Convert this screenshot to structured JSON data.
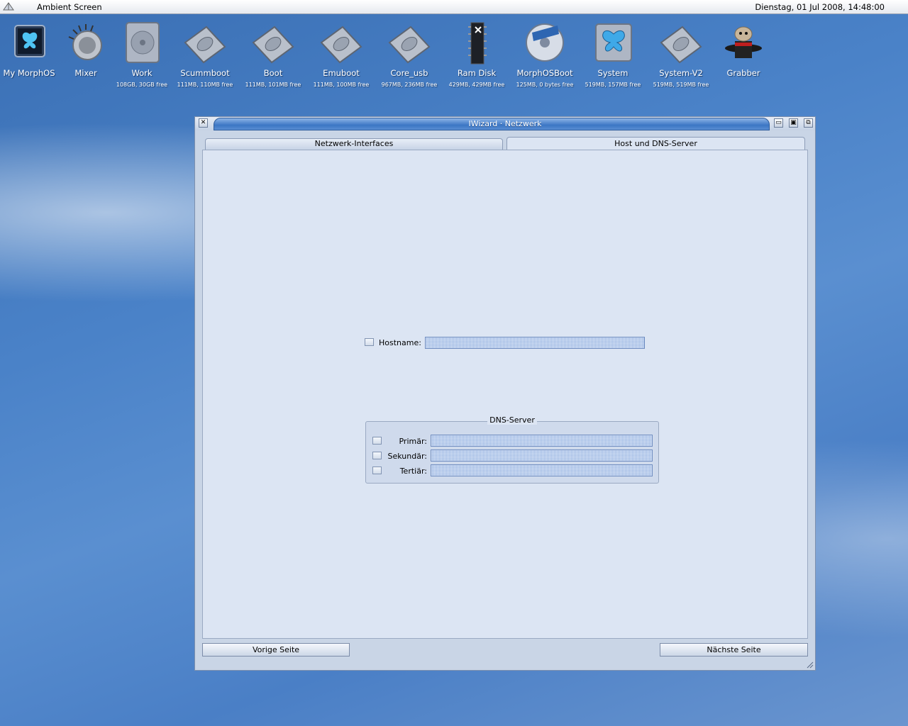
{
  "menubar": {
    "title": "Ambient Screen",
    "clock": "Dienstag, 01 Jul 2008, 14:48:00"
  },
  "desktop_icons": [
    {
      "label": "My MorphOS",
      "info": "",
      "icon": "morphos-butterfly-icon"
    },
    {
      "label": "Mixer",
      "info": "",
      "icon": "mixer-icon"
    },
    {
      "label": "Work",
      "info": "108GB, 30GB free",
      "icon": "harddisk-icon"
    },
    {
      "label": "Scummboot",
      "info": "111MB, 110MB free",
      "icon": "drive-icon"
    },
    {
      "label": "Boot",
      "info": "111MB, 101MB free",
      "icon": "drive-icon"
    },
    {
      "label": "Emuboot",
      "info": "111MB, 100MB free",
      "icon": "drive-icon"
    },
    {
      "label": "Core_usb",
      "info": "967MB, 236MB free",
      "icon": "drive-icon"
    },
    {
      "label": "Ram Disk",
      "info": "429MB, 429MB free",
      "icon": "ram-chip-icon"
    },
    {
      "label": "MorphOSBoot",
      "info": "125MB, 0 bytes free",
      "icon": "disc-icon"
    },
    {
      "label": "System",
      "info": "519MB, 157MB free",
      "icon": "system-butterfly-drive-icon"
    },
    {
      "label": "System-V2",
      "info": "519MB, 519MB free",
      "icon": "drive-icon"
    },
    {
      "label": "Grabber",
      "info": "",
      "icon": "magic-hat-icon"
    }
  ],
  "window": {
    "title": "IWizard · Netzwerk",
    "tabs": [
      "Netzwerk-Interfaces",
      "Host und DNS-Server"
    ],
    "active_tab": 1,
    "hostname_label": "Hostname:",
    "hostname_value": "",
    "dns_group_title": "DNS-Server",
    "dns_rows": [
      {
        "label": "Primär:",
        "value": ""
      },
      {
        "label": "Sekundär:",
        "value": ""
      },
      {
        "label": "Tertiär:",
        "value": ""
      }
    ],
    "prev_button": "Vorige Seite",
    "next_button": "Nächste Seite"
  },
  "colors": {
    "desktop": "#4a82c8",
    "window_bg": "#dce5f3",
    "titlebar": "#3c76c4",
    "field": "#8eaee0"
  }
}
